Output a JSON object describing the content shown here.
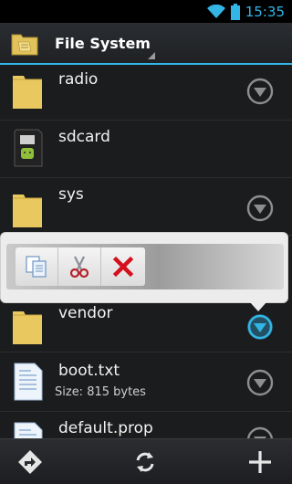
{
  "status_bar": {
    "time": "15:35"
  },
  "action_bar": {
    "title": "File System"
  },
  "files": [
    {
      "name": "radio",
      "type": "folder"
    },
    {
      "name": "sdcard",
      "type": "sdcard"
    },
    {
      "name": "sys",
      "type": "folder"
    },
    {
      "name": "vendor",
      "type": "folder",
      "selected": true
    },
    {
      "name": "boot.txt",
      "type": "text-file",
      "size": "Size: 815 bytes"
    },
    {
      "name": "default.prop",
      "type": "text-file"
    }
  ],
  "popup": {
    "actions": [
      "copy-icon",
      "cut-icon",
      "delete-icon"
    ]
  },
  "bottom_bar": {
    "buttons": [
      "share-icon",
      "refresh-icon",
      "add-icon"
    ]
  },
  "colors": {
    "accent": "#33b5e5",
    "folder": "#e9c860",
    "background": "#1b1c1e"
  }
}
